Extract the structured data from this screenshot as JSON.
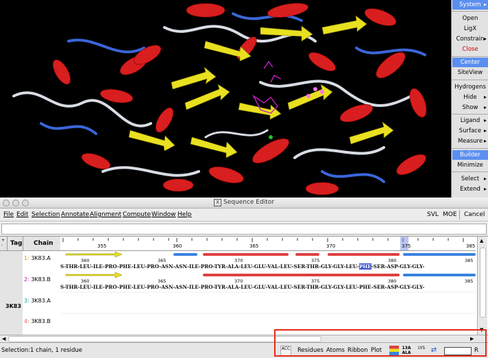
{
  "command_panel": {
    "items": [
      {
        "label": "System",
        "arrow": true,
        "selected": true
      },
      {
        "label": "Open"
      },
      {
        "label": "LigX"
      },
      {
        "label": "Constrain",
        "arrow": true
      },
      {
        "label": "Close",
        "red": true
      },
      {
        "label": "Center",
        "selected": true
      },
      {
        "label": "SiteView"
      },
      {
        "label": "Hydrogens"
      },
      {
        "label": "Hide",
        "arrow": true
      },
      {
        "label": "Show",
        "arrow": true
      },
      {
        "label": "Ligand",
        "arrow": true
      },
      {
        "label": "Surface",
        "arrow": true
      },
      {
        "label": "Measure",
        "arrow": true
      },
      {
        "label": "Builder",
        "selected": true
      },
      {
        "label": "Minimize"
      },
      {
        "label": "Select",
        "arrow": true
      },
      {
        "label": "Extend",
        "arrow": true
      }
    ]
  },
  "editor": {
    "title": "Sequence Editor",
    "menus": [
      "File",
      "Edit",
      "Selection",
      "Annotate",
      "Alignment",
      "Compute",
      "Window",
      "Help"
    ],
    "right_buttons": [
      "SVL",
      "MOE",
      "Cancel"
    ],
    "columns": {
      "tag": "Tag",
      "chain": "Chain"
    },
    "tag_value": "3K83",
    "chains": [
      {
        "num": "1:",
        "name": "3K83.A",
        "color": "#d09000"
      },
      {
        "num": "2:",
        "name": "3K83.B",
        "color": "#c000c0"
      },
      {
        "num": "3:",
        "name": "3K83.A",
        "color": "#00a0a0"
      },
      {
        "num": "4:",
        "name": "3K83.B",
        "color": "#e06060"
      }
    ],
    "ruler_ticks": [
      "355",
      "360",
      "365",
      "370",
      "375",
      "385"
    ],
    "ruler_tick_375": "375",
    "residue_numbers": [
      "360",
      "365",
      "370",
      "375",
      "380",
      "385"
    ],
    "sequence_1": {
      "before": "S-THR-LEU-ILE-PRO-PHE-LEU-PRO-ASN-ASN-ILE-PRO-TYR-ALA-LEU-GLU-VAL-LEU-SER-THR-GLY-GLY-LEU-",
      "selected": "PHE",
      "after": "-SER-ASP-GLY-GLY-"
    },
    "sequence_2": "S-THR-LEU-ILE-PRO-PHE-LEU-PRO-ASN-ASN-ILE-PRO-TYR-ALA-LEU-GLU-VAL-LEU-SER-THR-GLY-GLY-LEU-PHE-SER-ASP-GLY-GLY-",
    "status": "Selection:1 chain, 1 residue",
    "bottom_buttons": [
      "Residues",
      "Atoms",
      "Ribbon",
      "Plot"
    ],
    "bottom_icons": [
      {
        "name": "residue-color-icon",
        "text": "ACC"
      },
      {
        "name": "color-bars-icon",
        "text": ""
      },
      {
        "name": "thirteen-ala-icon",
        "text": "13A ALA"
      },
      {
        "name": "lys-icon",
        "text": "LYS"
      },
      {
        "name": "double-arrow-icon",
        "text": "⇄"
      }
    ],
    "r_label": "R"
  }
}
